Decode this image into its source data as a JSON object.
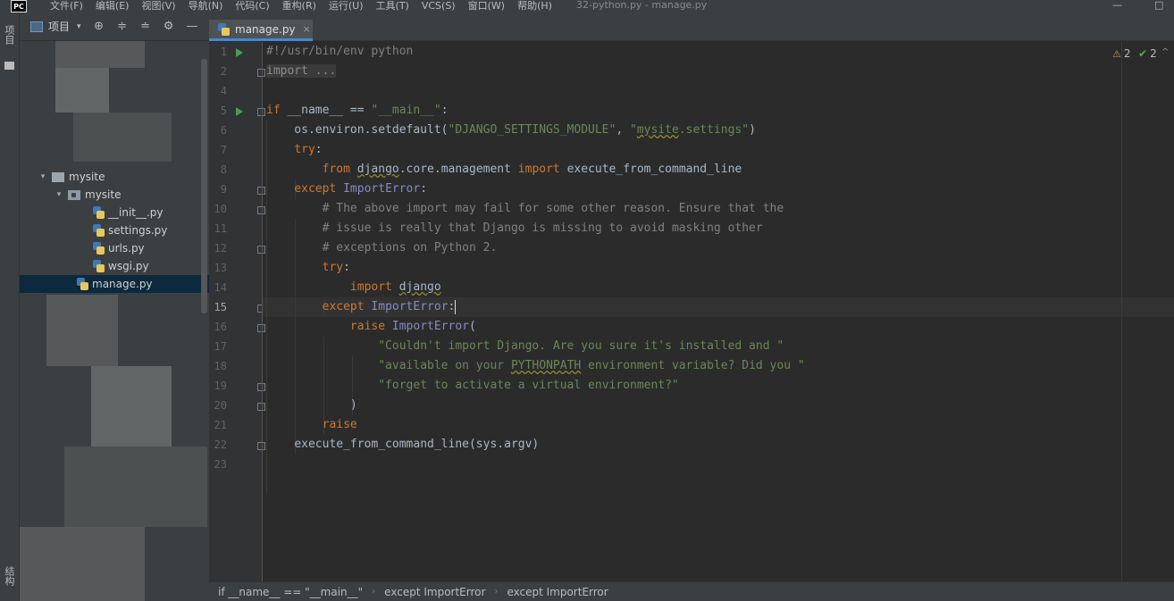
{
  "menubar": {
    "logo": "PC",
    "items": [
      "文件(F)",
      "编辑(E)",
      "视图(V)",
      "导航(N)",
      "代码(C)",
      "重构(R)",
      "运行(U)",
      "工具(T)",
      "VCS(S)",
      "窗口(W)",
      "帮助(H)"
    ],
    "title": "32-python.py - manage.py",
    "minimize": "—",
    "maximize": "□"
  },
  "toolstrip": {
    "project_label": "项目",
    "structure_label": "结构"
  },
  "project_panel": {
    "label": "项目",
    "dropdown": "▾",
    "buttons": [
      "⊕",
      "≑",
      "≐",
      "⚙",
      "—"
    ]
  },
  "tree": {
    "items": [
      {
        "label": "mysite",
        "type": "folder",
        "arrow": "▾"
      },
      {
        "label": "mysite",
        "type": "module",
        "arrow": "▾"
      },
      {
        "label": "__init__.py",
        "type": "py"
      },
      {
        "label": "settings.py",
        "type": "py"
      },
      {
        "label": "urls.py",
        "type": "py"
      },
      {
        "label": "wsgi.py",
        "type": "py"
      },
      {
        "label": "manage.py",
        "type": "py",
        "selected": true
      }
    ]
  },
  "editor": {
    "tab": {
      "label": "manage.py",
      "close": "×"
    },
    "line_numbers": [
      "1",
      "2",
      "4",
      "5",
      "6",
      "7",
      "8",
      "9",
      "10",
      "11",
      "12",
      "13",
      "14",
      "15",
      "16",
      "17",
      "18",
      "19",
      "20",
      "21",
      "22",
      "23"
    ],
    "current_line": "15",
    "warnings": "2",
    "checks": "2",
    "code": {
      "l1": "#!/usr/bin/env python",
      "l2": "import ...",
      "l5_kw": "if",
      "l5_a": " __name__ == ",
      "l5_str": "\"__main__\"",
      "l5_b": ":",
      "l6_a": "    os.environ.setdefault(",
      "l6_s1": "\"DJANGO_SETTINGS_MODULE\"",
      "l6_b": ", ",
      "l6_s2a": "\"",
      "l6_s2b": "mysite",
      "l6_s2c": ".settings\"",
      "l6_c": ")",
      "l7": "try",
      "l8_from": "from",
      "l8_mod1": "django",
      "l8_mod2": ".core.management ",
      "l8_import": "import",
      "l8_name": " execute_from_command_line",
      "l9_kw": "except",
      "l9_cls": "ImportError",
      "l10": "# The above import may fail for some other reason. Ensure that the",
      "l11": "# issue is really that Django is missing to avoid masking other",
      "l12": "# exceptions on Python 2.",
      "l13": "try",
      "l14_kw": "import",
      "l14_mod": "django",
      "l15_kw": "except",
      "l15_cls": "ImportError",
      "l16_kw": "raise",
      "l16_cls": "ImportError",
      "l17": "\"Couldn't import Django. Are you sure it's installed and \"",
      "l18_a": "\"available on your ",
      "l18_b": "PYTHONPATH",
      "l18_c": " environment variable? Did you \"",
      "l19": "\"forget to activate a virtual environment?\"",
      "l20": ")",
      "l21": "raise",
      "l22": "execute_from_command_line(sys.argv)"
    }
  },
  "breadcrumb": {
    "items": [
      "if __name__ == \"__main__\"",
      "except ImportError",
      "except ImportError"
    ],
    "separator": "›"
  }
}
